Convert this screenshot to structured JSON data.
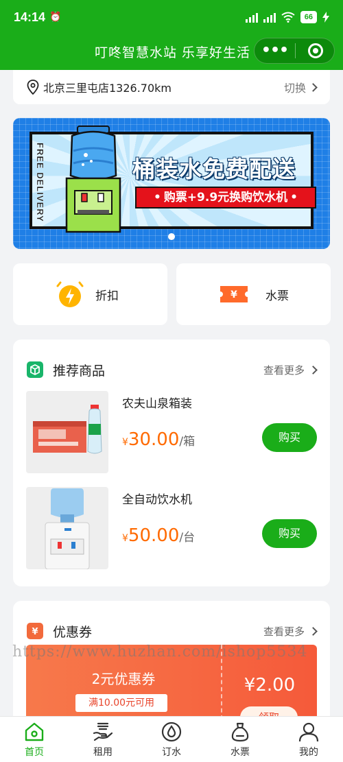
{
  "status_bar": {
    "time": "14:14",
    "battery": "66"
  },
  "header": {
    "title": "叮咚智慧水站 乐享好生活",
    "accent": "#1aad19"
  },
  "location": {
    "store": "北京三里屯店1326.70km",
    "switch_label": "切换"
  },
  "banner": {
    "side_text": "FREE DELIVERY",
    "headline": "桶装水免费配送",
    "subline": "购票+9.9元换购饮水机"
  },
  "quick_links": [
    {
      "label": "折扣",
      "icon": "lightning-icon"
    },
    {
      "label": "水票",
      "icon": "ticket-icon"
    }
  ],
  "recommend": {
    "title": "推荐商品",
    "more": "查看更多",
    "products": [
      {
        "name": "农夫山泉箱装",
        "currency": "¥",
        "price": "30.00",
        "unit": "/箱",
        "buy": "购买"
      },
      {
        "name": "全自动饮水机",
        "currency": "¥",
        "price": "50.00",
        "unit": "/台",
        "buy": "购买"
      }
    ]
  },
  "coupons": {
    "title": "优惠券",
    "more": "查看更多",
    "items": [
      {
        "name": "2元优惠券",
        "condition": "满10.00元可用",
        "amount": "¥2.00",
        "claim": "领取"
      }
    ]
  },
  "watermark": "https://www.huzhan.com/ishop5534",
  "tabbar": [
    {
      "label": "首页",
      "icon": "home-icon",
      "active": true
    },
    {
      "label": "租用",
      "icon": "rent-icon",
      "active": false
    },
    {
      "label": "订水",
      "icon": "water-drop-icon",
      "active": false
    },
    {
      "label": "水票",
      "icon": "bag-icon",
      "active": false
    },
    {
      "label": "我的",
      "icon": "user-icon",
      "active": false
    }
  ]
}
